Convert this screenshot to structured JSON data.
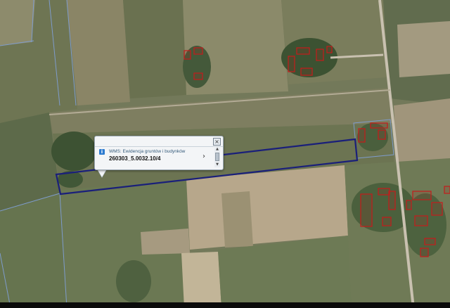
{
  "map": {
    "base_layer_colors": {
      "field_light": "#8d8c6a",
      "field_dark": "#5f6b4c",
      "field_green": "#6f7d57",
      "bare_soil": "#b7a58a",
      "trees": "#3c5232",
      "road": "#c9c1b0"
    },
    "overlay": {
      "parcel_outline_color": "#1a1f7a",
      "building_outline_color": "#c41c1c",
      "parcel_boundary_color": "#7e9ccc"
    }
  },
  "popup": {
    "layer_name": "WMS: Ewidencja gruntów i budynków",
    "parcel_id": "260303_5.0032.10/4",
    "close_label": "×",
    "info_icon": "info-icon",
    "next_icon": "chevron-right-icon",
    "next_label": "›",
    "scroll_up_label": "▲",
    "scroll_down_label": "▼"
  }
}
